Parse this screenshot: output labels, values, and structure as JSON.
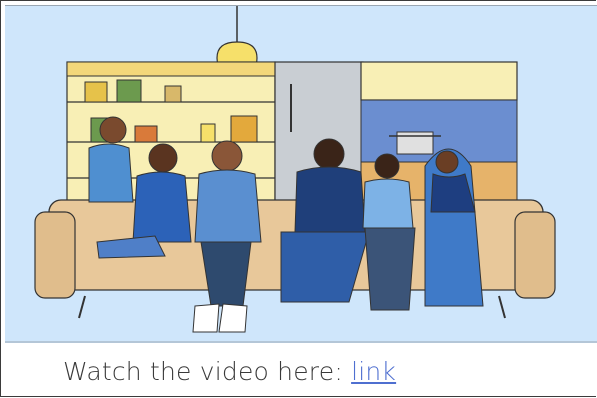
{
  "caption": {
    "text": "Watch the video here: ",
    "link_label": "link"
  },
  "colors": {
    "sky_bg": "#cfe6fb",
    "link": "#4f6fd0",
    "caption_text": "#3a3a3a"
  }
}
